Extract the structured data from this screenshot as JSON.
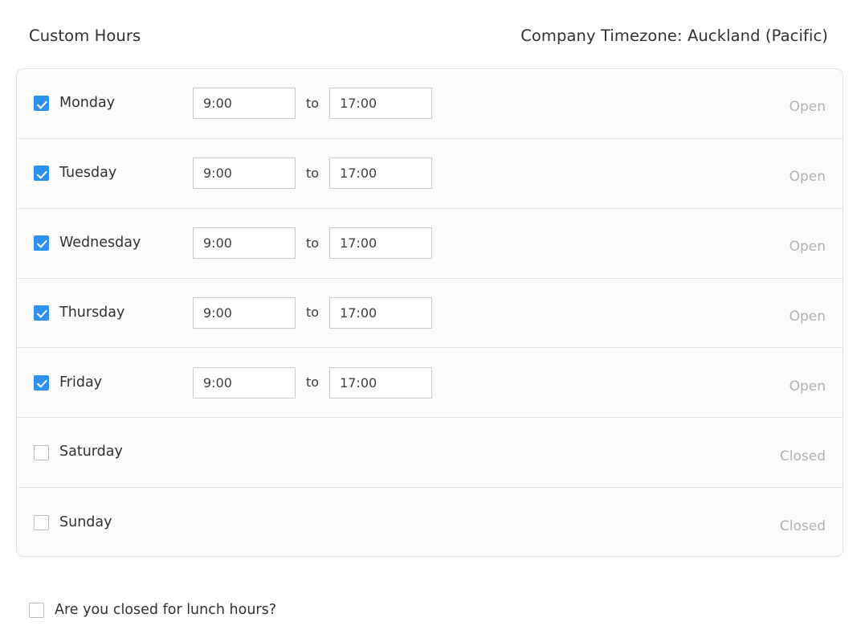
{
  "header": {
    "title": "Custom Hours",
    "timezone_label": "Company Timezone:",
    "timezone_value": "Auckland (Pacific)"
  },
  "colors": {
    "checkbox_checked": "#2e91f0",
    "checkbox_border": "#b9bcc0",
    "card_border": "#e0e0e0",
    "row_background": "#fbfbfb",
    "status_text": "#b0b3b8",
    "text": "#2f3337"
  },
  "schedule": {
    "to_separator": "to",
    "rows": [
      {
        "day": "Monday",
        "checked": true,
        "open_time": "9:00",
        "close_time": "17:00",
        "status": "Open"
      },
      {
        "day": "Tuesday",
        "checked": true,
        "open_time": "9:00",
        "close_time": "17:00",
        "status": "Open"
      },
      {
        "day": "Wednesday",
        "checked": true,
        "open_time": "9:00",
        "close_time": "17:00",
        "status": "Open"
      },
      {
        "day": "Thursday",
        "checked": true,
        "open_time": "9:00",
        "close_time": "17:00",
        "status": "Open"
      },
      {
        "day": "Friday",
        "checked": true,
        "open_time": "9:00",
        "close_time": "17:00",
        "status": "Open"
      },
      {
        "day": "Saturday",
        "checked": false,
        "open_time": null,
        "close_time": null,
        "status": "Closed"
      },
      {
        "day": "Sunday",
        "checked": false,
        "open_time": null,
        "close_time": null,
        "status": "Closed"
      }
    ]
  },
  "lunch": {
    "checked": false,
    "label": "Are you closed for lunch hours?"
  }
}
